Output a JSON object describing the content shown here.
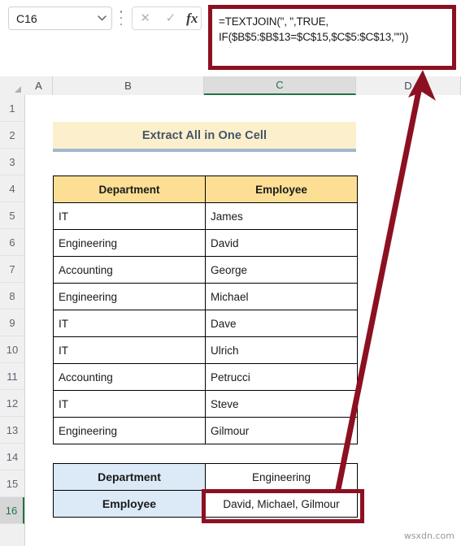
{
  "formula_bar": {
    "name_box_value": "C16",
    "name_box_chevron_icon": "chevron-down-icon",
    "cancel_icon": "✕",
    "confirm_icon": "✓",
    "fx_icon": "fx",
    "formula": "=TEXTJOIN(\", \",TRUE,\nIF($B$5:$B$13=$C$15,$C$5:$C$13,\"\"))"
  },
  "grid": {
    "columns": [
      {
        "label": "A",
        "selected": false
      },
      {
        "label": "B",
        "selected": false
      },
      {
        "label": "C",
        "selected": true
      },
      {
        "label": "D",
        "selected": false
      }
    ],
    "rows": [
      {
        "label": "1",
        "selected": false
      },
      {
        "label": "2",
        "selected": false
      },
      {
        "label": "3",
        "selected": false
      },
      {
        "label": "4",
        "selected": false
      },
      {
        "label": "5",
        "selected": false
      },
      {
        "label": "6",
        "selected": false
      },
      {
        "label": "7",
        "selected": false
      },
      {
        "label": "8",
        "selected": false
      },
      {
        "label": "9",
        "selected": false
      },
      {
        "label": "10",
        "selected": false
      },
      {
        "label": "11",
        "selected": false
      },
      {
        "label": "12",
        "selected": false
      },
      {
        "label": "13",
        "selected": false
      },
      {
        "label": "14",
        "selected": false
      },
      {
        "label": "15",
        "selected": false
      },
      {
        "label": "16",
        "selected": true
      }
    ]
  },
  "title_banner": {
    "text": "Extract All in One Cell"
  },
  "main_table": {
    "headers": [
      "Department",
      "Employee"
    ],
    "rows": [
      [
        "IT",
        "James"
      ],
      [
        "Engineering",
        "David"
      ],
      [
        "Accounting",
        "George"
      ],
      [
        "Engineering",
        "Michael"
      ],
      [
        "IT",
        "Dave"
      ],
      [
        "IT",
        "Ulrich"
      ],
      [
        "Accounting",
        "Petrucci"
      ],
      [
        "IT",
        "Steve"
      ],
      [
        "Engineering",
        "Gilmour"
      ]
    ]
  },
  "result_table": {
    "rows": [
      {
        "label": "Department",
        "value": "Engineering"
      },
      {
        "label": "Employee",
        "value": "David, Michael, Gilmour"
      }
    ]
  },
  "annotations": {
    "arrow_icon": "up-arrow-annotation",
    "highlight_icon": "cell-highlight-box",
    "accent_color": "#8C1021"
  },
  "watermark": {
    "text": "wsxdn.com"
  }
}
